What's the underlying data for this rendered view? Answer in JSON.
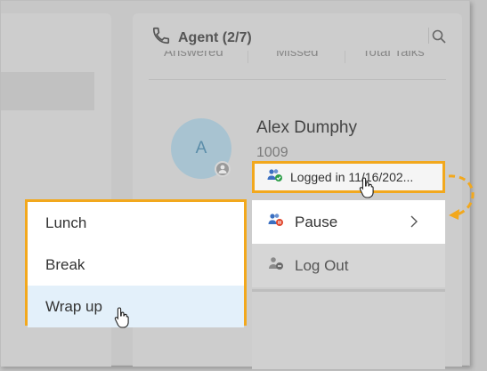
{
  "header": {
    "title": "Agent (2/7)"
  },
  "stats": {
    "answered": "Answered",
    "missed": "Missed",
    "total": "Total Talks"
  },
  "agent": {
    "initial": "A",
    "name": "Alex Dumphy",
    "extension": "1009"
  },
  "status": {
    "label": "Logged in 11/16/202..."
  },
  "menu": {
    "pause": "Pause",
    "logout": "Log Out"
  },
  "submenu": {
    "items": [
      "Lunch",
      "Break",
      "Wrap up"
    ]
  },
  "colors": {
    "highlight": "#f2a81d",
    "hover": "#e3f0fa",
    "avatar": "#a8c3d1"
  }
}
